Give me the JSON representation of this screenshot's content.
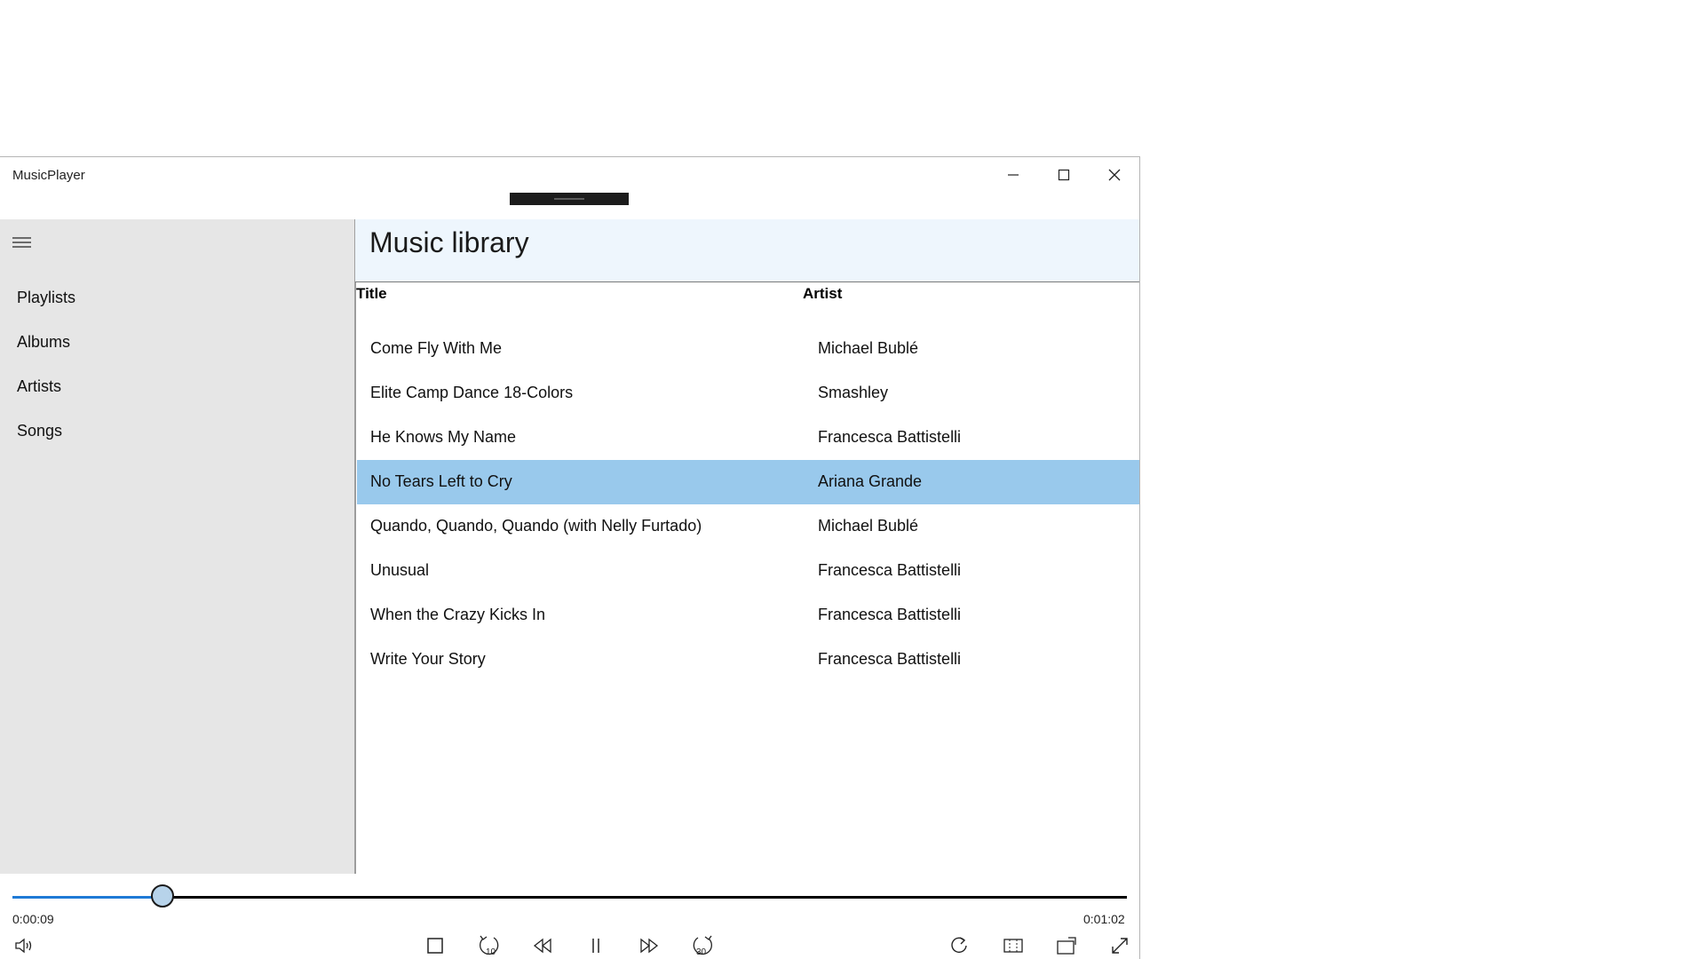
{
  "window": {
    "title": "MusicPlayer"
  },
  "sidebar": {
    "items": [
      {
        "label": "Playlists"
      },
      {
        "label": "Albums"
      },
      {
        "label": "Artists"
      },
      {
        "label": "Songs"
      }
    ]
  },
  "library": {
    "title": "Music library",
    "columns": {
      "title": "Title",
      "artist": "Artist"
    },
    "rows": [
      {
        "title": "Come Fly With Me",
        "artist": "Michael Bublé"
      },
      {
        "title": "Elite Camp Dance 18-Colors",
        "artist": "Smashley"
      },
      {
        "title": "He Knows My Name",
        "artist": "Francesca Battistelli"
      },
      {
        "title": "No Tears Left to Cry",
        "artist": "Ariana Grande",
        "selected": true
      },
      {
        "title": "Quando, Quando, Quando (with Nelly Furtado)",
        "artist": "Michael Bublé"
      },
      {
        "title": "Unusual",
        "artist": "Francesca Battistelli"
      },
      {
        "title": "When the Crazy Kicks In",
        "artist": "Francesca Battistelli"
      },
      {
        "title": "Write Your Story",
        "artist": "Francesca Battistelli"
      }
    ]
  },
  "player": {
    "elapsed": "0:00:09",
    "duration": "0:01:02",
    "progress_fraction": 0.135,
    "skip_back_seconds": "10",
    "skip_forward_seconds": "30"
  },
  "colors": {
    "selected_row": "#99c9ec",
    "accent": "#1f7ad6",
    "sidebar_bg": "#e6e6e6",
    "header_bg": "#eef6fd"
  }
}
